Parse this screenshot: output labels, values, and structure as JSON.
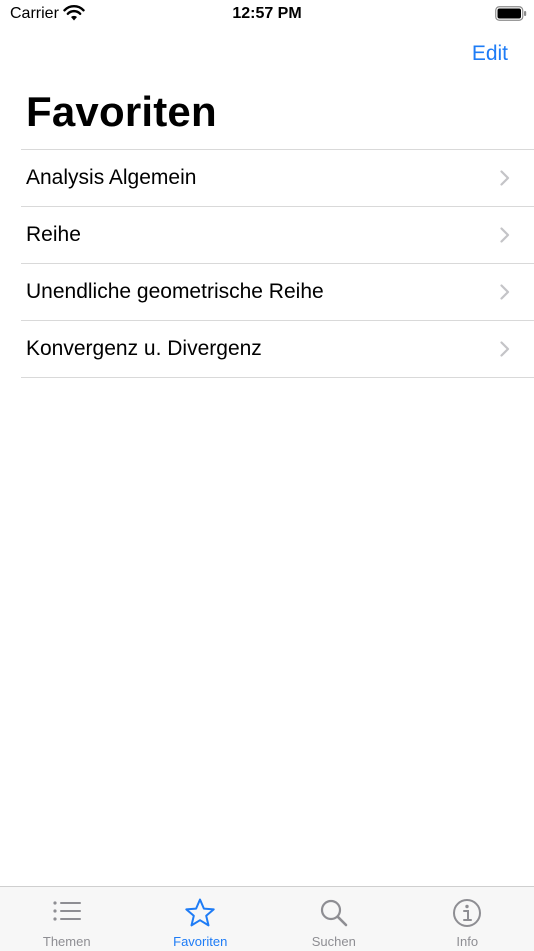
{
  "status_bar": {
    "carrier": "Carrier",
    "time": "12:57 PM"
  },
  "nav": {
    "edit_label": "Edit",
    "title": "Favoriten"
  },
  "favorites": [
    {
      "label": "Analysis Algemein"
    },
    {
      "label": "Reihe"
    },
    {
      "label": "Unendliche geometrische Reihe"
    },
    {
      "label": "Konvergenz u. Divergenz"
    }
  ],
  "tab_bar": {
    "tabs": [
      {
        "label": "Themen",
        "icon": "list-icon"
      },
      {
        "label": "Favoriten",
        "icon": "star-icon",
        "selected": true
      },
      {
        "label": "Suchen",
        "icon": "search-icon"
      },
      {
        "label": "Info",
        "icon": "info-icon"
      }
    ]
  },
  "colors": {
    "accent": "#1e7cf6",
    "inactive": "#8e8e93"
  }
}
